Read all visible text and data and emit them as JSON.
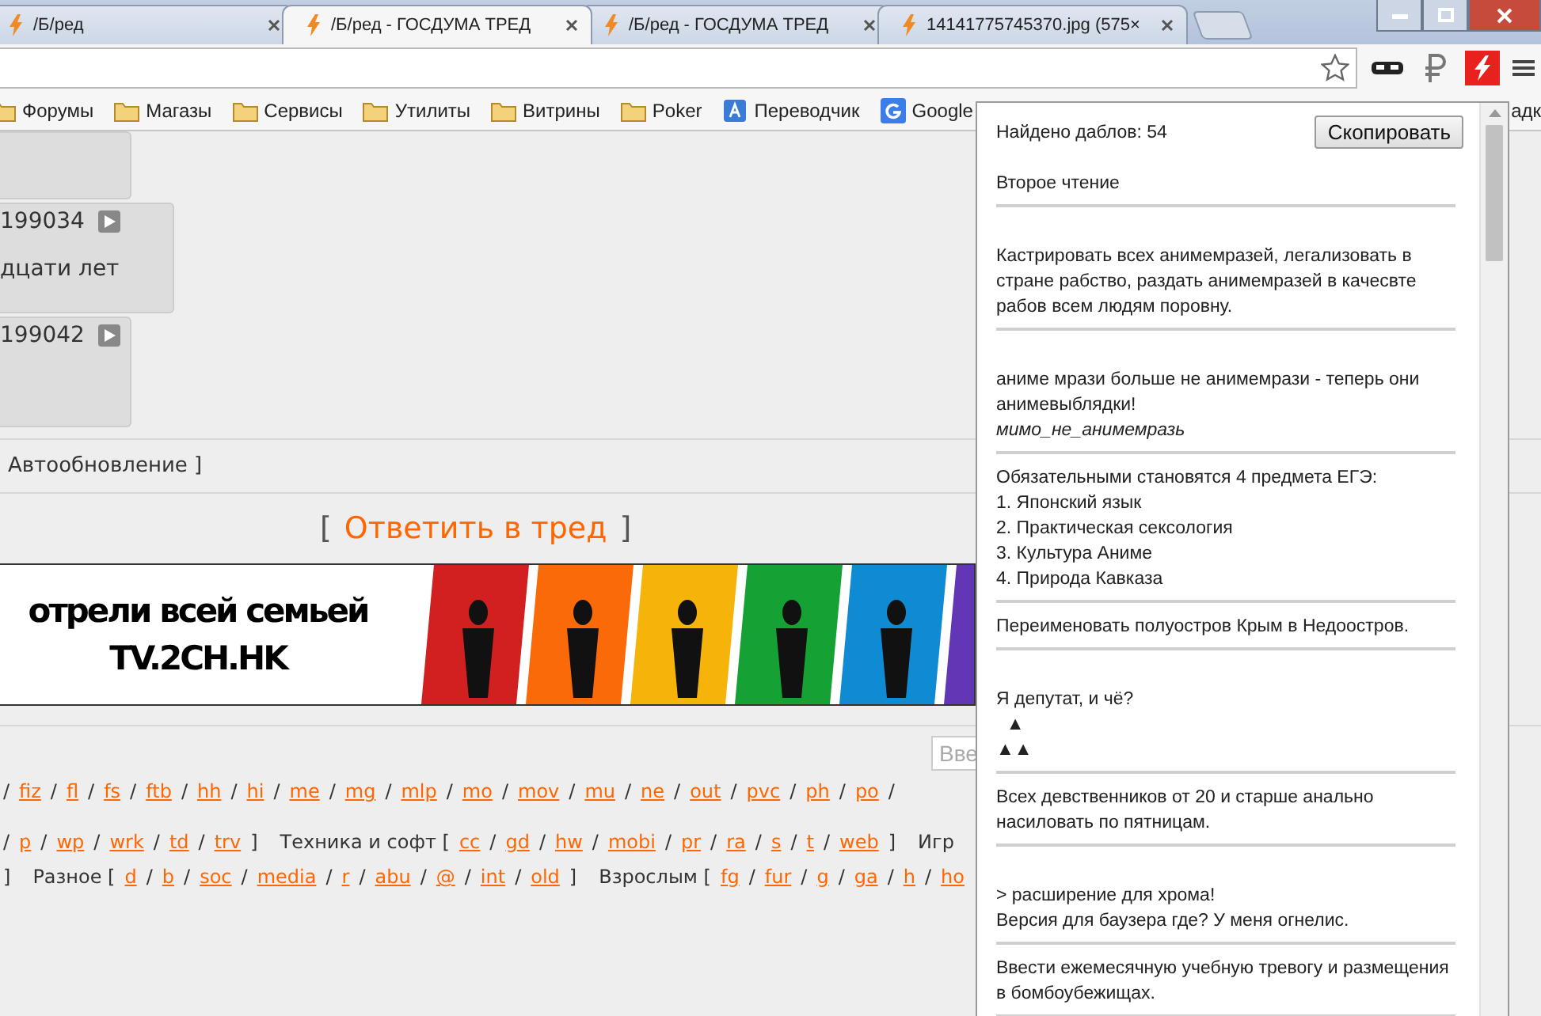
{
  "tabs": [
    {
      "title": "/Б/ред",
      "selected": false
    },
    {
      "title": "/Б/ред - ГОСДУМА ТРЕД",
      "selected": true
    },
    {
      "title": "/Б/ред - ГОСДУМА ТРЕД",
      "selected": false
    },
    {
      "title": "14141775745370.jpg (575×",
      "selected": false
    }
  ],
  "bookmarks": [
    {
      "label": "Форумы",
      "kind": "folder"
    },
    {
      "label": "Магазы",
      "kind": "folder"
    },
    {
      "label": "Сервисы",
      "kind": "folder"
    },
    {
      "label": "Утилиты",
      "kind": "folder"
    },
    {
      "label": "Витрины",
      "kind": "folder"
    },
    {
      "label": "Poker",
      "kind": "folder"
    },
    {
      "label": "Переводчик",
      "kind": "translate"
    },
    {
      "label": "Google",
      "kind": "google"
    }
  ],
  "bookmarks_overflow": "адк",
  "posts": [
    {
      "number": "199034",
      "text": "дцати лет"
    },
    {
      "number": "199042"
    }
  ],
  "autoupdate": "Автообновление ]",
  "reply": {
    "open": "[",
    "label": "Ответить в тред",
    "close": "]"
  },
  "banner": {
    "line_1": "отрели всей семьей",
    "line_2": "TV.2CH.HK"
  },
  "search": {
    "placeholder": "Вве"
  },
  "board_rows": [
    [
      {
        "kind": "sep",
        "text": "/"
      },
      {
        "kind": "link",
        "text": "fiz"
      },
      {
        "kind": "sep",
        "text": "/"
      },
      {
        "kind": "link",
        "text": "fl"
      },
      {
        "kind": "sep",
        "text": "/"
      },
      {
        "kind": "link",
        "text": "fs"
      },
      {
        "kind": "sep",
        "text": "/"
      },
      {
        "kind": "link",
        "text": "ftb"
      },
      {
        "kind": "sep",
        "text": "/"
      },
      {
        "kind": "link",
        "text": "hh"
      },
      {
        "kind": "sep",
        "text": "/"
      },
      {
        "kind": "link",
        "text": "hi"
      },
      {
        "kind": "sep",
        "text": "/"
      },
      {
        "kind": "link",
        "text": "me"
      },
      {
        "kind": "sep",
        "text": "/"
      },
      {
        "kind": "link",
        "text": "mg"
      },
      {
        "kind": "sep",
        "text": "/"
      },
      {
        "kind": "link",
        "text": "mlp"
      },
      {
        "kind": "sep",
        "text": "/"
      },
      {
        "kind": "link",
        "text": "mo"
      },
      {
        "kind": "sep",
        "text": "/"
      },
      {
        "kind": "link",
        "text": "mov"
      },
      {
        "kind": "sep",
        "text": "/"
      },
      {
        "kind": "link",
        "text": "mu"
      },
      {
        "kind": "sep",
        "text": "/"
      },
      {
        "kind": "link",
        "text": "ne"
      },
      {
        "kind": "sep",
        "text": "/"
      },
      {
        "kind": "link",
        "text": "out"
      },
      {
        "kind": "sep",
        "text": "/"
      },
      {
        "kind": "link",
        "text": "pvc"
      },
      {
        "kind": "sep",
        "text": "/"
      },
      {
        "kind": "link",
        "text": "ph"
      },
      {
        "kind": "sep",
        "text": "/"
      },
      {
        "kind": "link",
        "text": "po"
      },
      {
        "kind": "sep",
        "text": "/"
      }
    ],
    [
      {
        "kind": "sep",
        "text": "/"
      },
      {
        "kind": "link",
        "text": "p"
      },
      {
        "kind": "sep",
        "text": "/"
      },
      {
        "kind": "link",
        "text": "wp"
      },
      {
        "kind": "sep",
        "text": "/"
      },
      {
        "kind": "link",
        "text": "wrk"
      },
      {
        "kind": "sep",
        "text": "/"
      },
      {
        "kind": "link",
        "text": "td"
      },
      {
        "kind": "sep",
        "text": "/"
      },
      {
        "kind": "link",
        "text": "trv"
      },
      {
        "kind": "sep",
        "text": "]"
      },
      {
        "kind": "label",
        "text": "Техника и софт ["
      },
      {
        "kind": "link",
        "text": "cc"
      },
      {
        "kind": "sep",
        "text": "/"
      },
      {
        "kind": "link",
        "text": "gd"
      },
      {
        "kind": "sep",
        "text": "/"
      },
      {
        "kind": "link",
        "text": "hw"
      },
      {
        "kind": "sep",
        "text": "/"
      },
      {
        "kind": "link",
        "text": "mobi"
      },
      {
        "kind": "sep",
        "text": "/"
      },
      {
        "kind": "link",
        "text": "pr"
      },
      {
        "kind": "sep",
        "text": "/"
      },
      {
        "kind": "link",
        "text": "ra"
      },
      {
        "kind": "sep",
        "text": "/"
      },
      {
        "kind": "link",
        "text": "s"
      },
      {
        "kind": "sep",
        "text": "/"
      },
      {
        "kind": "link",
        "text": "t"
      },
      {
        "kind": "sep",
        "text": "/"
      },
      {
        "kind": "link",
        "text": "web"
      },
      {
        "kind": "sep",
        "text": "]"
      },
      {
        "kind": "label",
        "text": "Игр"
      }
    ],
    [
      {
        "kind": "sep",
        "text": "]"
      },
      {
        "kind": "label",
        "text": "Разное ["
      },
      {
        "kind": "link",
        "text": "d"
      },
      {
        "kind": "sep",
        "text": "/"
      },
      {
        "kind": "link",
        "text": "b"
      },
      {
        "kind": "sep",
        "text": "/"
      },
      {
        "kind": "link",
        "text": "soc"
      },
      {
        "kind": "sep",
        "text": "/"
      },
      {
        "kind": "link",
        "text": "media"
      },
      {
        "kind": "sep",
        "text": "/"
      },
      {
        "kind": "link",
        "text": "r"
      },
      {
        "kind": "sep",
        "text": "/"
      },
      {
        "kind": "link",
        "text": "abu"
      },
      {
        "kind": "sep",
        "text": "/"
      },
      {
        "kind": "link",
        "text": "@"
      },
      {
        "kind": "sep",
        "text": "/"
      },
      {
        "kind": "link",
        "text": "int"
      },
      {
        "kind": "sep",
        "text": "/"
      },
      {
        "kind": "link",
        "text": "old"
      },
      {
        "kind": "sep",
        "text": "]"
      },
      {
        "kind": "label",
        "text": "Взрослым ["
      },
      {
        "kind": "link",
        "text": "fg"
      },
      {
        "kind": "sep",
        "text": "/"
      },
      {
        "kind": "link",
        "text": "fur"
      },
      {
        "kind": "sep",
        "text": "/"
      },
      {
        "kind": "link",
        "text": "g"
      },
      {
        "kind": "sep",
        "text": "/"
      },
      {
        "kind": "link",
        "text": "ga"
      },
      {
        "kind": "sep",
        "text": "/"
      },
      {
        "kind": "link",
        "text": "h"
      },
      {
        "kind": "sep",
        "text": "/"
      },
      {
        "kind": "link",
        "text": "ho"
      }
    ]
  ],
  "popup": {
    "count": "Найдено даблов: 54",
    "copy_button": "Скопировать",
    "entries": [
      {
        "text": "Второе чтение",
        "blank_first_line": false
      },
      {
        "text": "Кастрировать всех анимемразей, легализовать в стране рабство, раздать анимемразей в качесвте рабов всем людям поровну.",
        "blank_first_line": true
      },
      {
        "text": "аниме мрази больше не анимемрази - теперь они анимевыблядки!",
        "signature": "мимо_не_анимемразь",
        "blank_first_line": true
      },
      {
        "text": "Обязательными становятся 4 предмета ЕГЭ:\n1. Японский язык\n2. Практическая сексология\n3. Культура Аниме\n4. Природа Кавказа",
        "blank_first_line": false
      },
      {
        "text": "Переименовать полуостров Крым в Недоостров.",
        "blank_first_line": false
      },
      {
        "text": "Я депутат, и чё?\n  ▲\n▲▲",
        "blank_first_line": true
      },
      {
        "text": "Всех девственников от 20 и старше анально насиловать по пятницам.",
        "blank_first_line": false
      },
      {
        "text": "> расширение для хрома!\nВерсия для баузера где? У меня огнелис.",
        "blank_first_line": true
      },
      {
        "text": "Ввести ежемесячную учебную тревогу и размещения в бомбоубежищах.",
        "blank_first_line": false
      }
    ]
  }
}
